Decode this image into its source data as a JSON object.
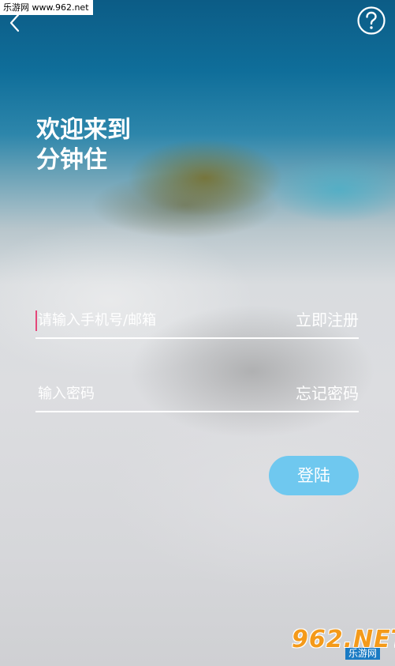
{
  "watermark": {
    "top_text": "乐游网 www.962.net",
    "logo_text": "962.NET",
    "logo_sub": "乐游网"
  },
  "header": {
    "back_icon": "chevron-left-icon",
    "help_icon": "question-circle-icon"
  },
  "welcome": {
    "line1": "欢迎来到",
    "line2": "分钟住"
  },
  "account_field": {
    "placeholder": "请输入手机号/邮箱",
    "value": "",
    "link_label": "立即注册"
  },
  "password_field": {
    "placeholder": "输入密码",
    "value": "",
    "link_label": "忘记密码"
  },
  "login_button": {
    "label": "登陆"
  },
  "colors": {
    "accent": "#6fc8ef",
    "caret": "#e4467a",
    "text": "#ffffff"
  }
}
